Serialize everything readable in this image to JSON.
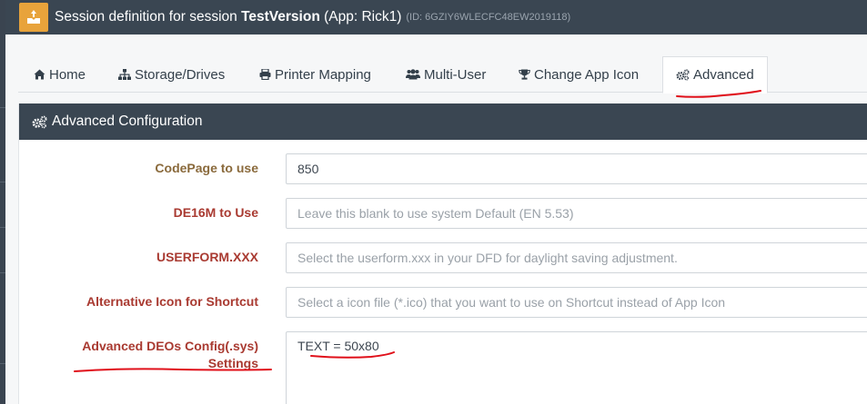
{
  "titlebar": {
    "prefix": "Session definition for session ",
    "session_name": "TestVersion",
    "app_text": " (App: Rick1)",
    "session_id": "(ID: 6GZIY6WLECFC48EW2019118)"
  },
  "tabs": [
    {
      "label": "Home",
      "icon": "home-icon"
    },
    {
      "label": "Storage/Drives",
      "icon": "sitemap-icon"
    },
    {
      "label": "Printer Mapping",
      "icon": "printer-icon"
    },
    {
      "label": "Multi-User",
      "icon": "users-icon"
    },
    {
      "label": "Change App Icon",
      "icon": "trophy-icon"
    },
    {
      "label": "Advanced",
      "icon": "gears-icon",
      "active": true
    }
  ],
  "panel": {
    "title": "Advanced Configuration",
    "icon": "gears-icon"
  },
  "fields": {
    "codepage": {
      "label": "CodePage to use",
      "value": "850"
    },
    "de16m": {
      "label": "DE16M to Use",
      "placeholder": "Leave this blank to use system Default (EN 5.53)"
    },
    "userform": {
      "label": "USERFORM.XXX",
      "placeholder": "Select the userform.xxx in your DFD for daylight saving adjustment."
    },
    "alt_icon": {
      "label": "Alternative Icon for Shortcut",
      "placeholder": "Select a icon file (*.ico) that you want to use on Shortcut instead of App Icon"
    },
    "deos_config": {
      "label_line1": "Advanced DEOs Config(.sys)",
      "label_line2": "Settings",
      "value": "TEXT = 50x80"
    }
  },
  "colors": {
    "header_bg": "#3a4652",
    "label_red": "#a93a31",
    "label_brown": "#8a6a3c",
    "logo": "#e8a33b",
    "annotation": "#e0101a"
  }
}
